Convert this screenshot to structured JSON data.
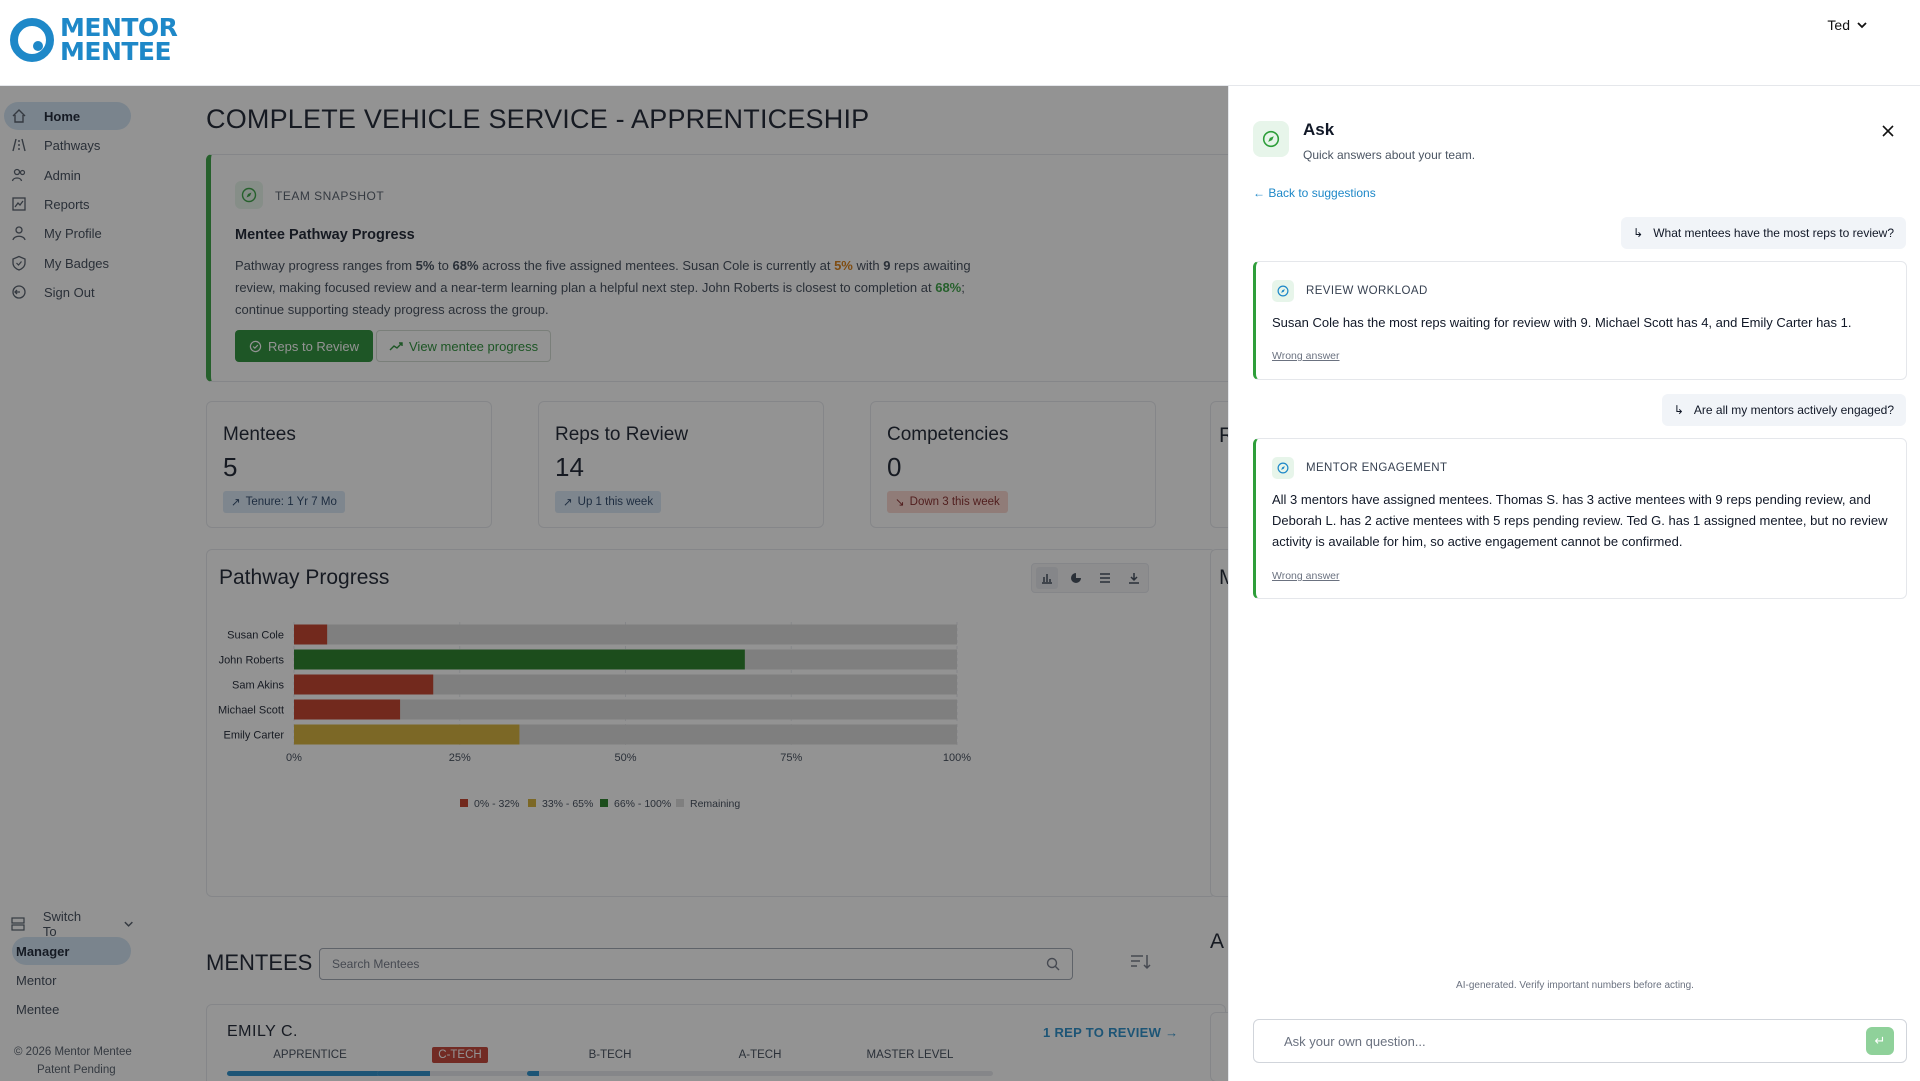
{
  "header": {
    "logo_line1": "MENTOR",
    "logo_line2": "MENTEE",
    "user_name": "Ted"
  },
  "sidebar": {
    "items": [
      {
        "label": "Home",
        "icon": "home-icon",
        "active": true
      },
      {
        "label": "Pathways",
        "icon": "road-icon"
      },
      {
        "label": "Admin",
        "icon": "users-icon"
      },
      {
        "label": "Reports",
        "icon": "chart-icon"
      },
      {
        "label": "My Profile",
        "icon": "user-icon"
      },
      {
        "label": "My Badges",
        "icon": "shield-icon"
      },
      {
        "label": "Sign Out",
        "icon": "signout-icon"
      }
    ],
    "switch_label": "Switch To",
    "roles": [
      {
        "label": "Manager",
        "active": true
      },
      {
        "label": "Mentor"
      },
      {
        "label": "Mentee"
      }
    ],
    "copyright": "© 2026 Mentor Mentee",
    "patent": "Patent Pending"
  },
  "main": {
    "title": "COMPLETE VEHICLE SERVICE - APPRENTICESHIP",
    "snapshot": {
      "label": "TEAM SNAPSHOT",
      "title": "Mentee Pathway Progress",
      "text_parts": {
        "a": "Pathway progress ranges from ",
        "b": "5%",
        "c": " to ",
        "d": "68%",
        "e": " across the five assigned mentees. Susan Cole is currently at ",
        "f": "5%",
        "g": " with ",
        "h": "9",
        "i": " reps awaiting review, making focused review and a near-term learning plan a helpful next step. John Roberts is closest to completion at ",
        "j": "68%",
        "k": "; continue supporting steady progress across the group."
      },
      "btn_primary": "Reps to Review",
      "btn_secondary": "View mentee progress"
    },
    "stats": [
      {
        "label": "Mentees",
        "value": "5",
        "badge": "Tenure: 1 Yr 7 Mo",
        "trend": "up"
      },
      {
        "label": "Reps to Review",
        "value": "14",
        "badge": "Up 1 this week",
        "trend": "up"
      },
      {
        "label": "Competencies",
        "value": "0",
        "badge": "Down 3 this week",
        "trend": "down"
      }
    ],
    "edge_letters": {
      "stat4": "R",
      "card2": "M",
      "section2": "A"
    },
    "chart_title": "Pathway Progress",
    "mentees_title": "MENTEES",
    "search_placeholder": "Search Mentees",
    "mentee": {
      "name": "EMILY C.",
      "review_link": "1 REP TO REVIEW",
      "stages": [
        {
          "label": "APPRENTICE",
          "progress": 1.0
        },
        {
          "label": "C-TECH",
          "progress": 0.32,
          "current": true
        },
        {
          "label": "B-TECH",
          "progress": 0.07
        },
        {
          "label": "A-TECH",
          "progress": 0
        },
        {
          "label": "MASTER LEVEL",
          "progress": 0
        }
      ]
    }
  },
  "chart_data": {
    "type": "bar",
    "orientation": "horizontal",
    "stacked": true,
    "title": "Pathway Progress",
    "categories": [
      "Susan Cole",
      "John Roberts",
      "Sam Akins",
      "Michael Scott",
      "Emily Carter"
    ],
    "values": [
      5,
      68,
      21,
      16,
      34
    ],
    "xlim": [
      0,
      100
    ],
    "x_ticks": [
      "0%",
      "25%",
      "50%",
      "75%",
      "100%"
    ],
    "legend": [
      {
        "label": "0% - 32%",
        "color": "#c0341d"
      },
      {
        "label": "33% - 65%",
        "color": "#d4ad2f"
      },
      {
        "label": "66% - 100%",
        "color": "#1c7a1c"
      },
      {
        "label": "Remaining",
        "color": "#d9d9d9"
      }
    ],
    "legend_position": "bottom"
  },
  "ask_panel": {
    "title": "Ask",
    "subtitle": "Quick answers about your team.",
    "back_link": "← Back to suggestions",
    "conversation": [
      {
        "question": "What mentees have the most reps to review?",
        "label": "REVIEW WORKLOAD",
        "answer": "Susan Cole has the most reps waiting for review with 9. Michael Scott has 4, and Emily Carter has 1.",
        "wrong": "Wrong answer"
      },
      {
        "question": "Are all my mentors actively engaged?",
        "label": "MENTOR ENGAGEMENT",
        "answer": "All 3 mentors have assigned mentees. Thomas S. has 3 active mentees with 9 reps pending review, and Deborah L. has 2 active mentees with 5 reps pending review. Ted G. has 1 assigned mentee, but no review activity is available for him, so active engagement cannot be confirmed.",
        "wrong": "Wrong answer"
      }
    ],
    "disclaimer": "AI-generated. Verify important numbers before acting.",
    "input_placeholder": "Ask your own question..."
  }
}
